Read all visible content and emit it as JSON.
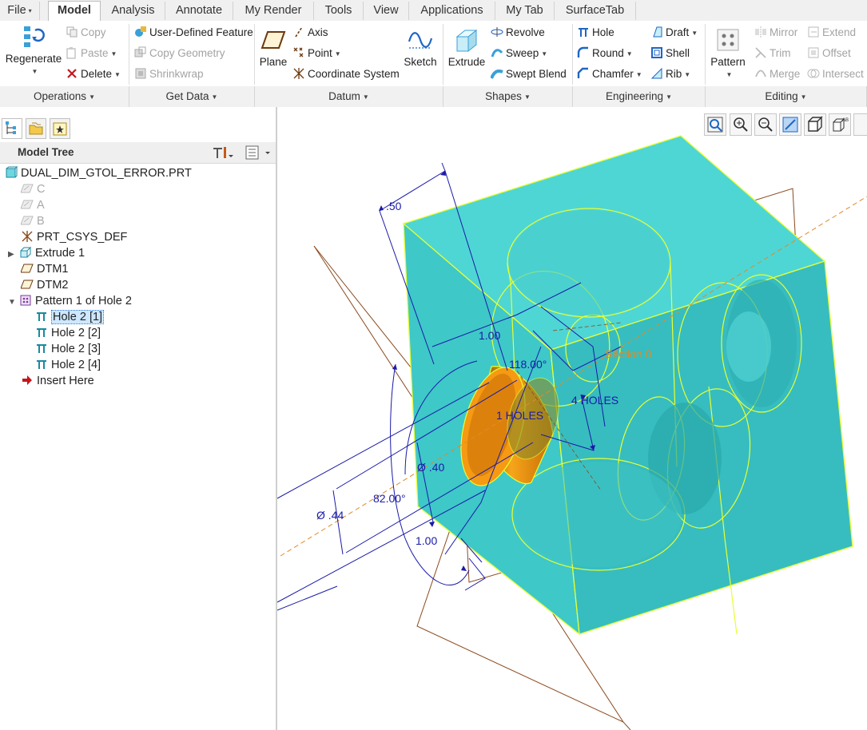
{
  "tabs": [
    {
      "label": "File",
      "caret": "▾"
    },
    {
      "label": "Model"
    },
    {
      "label": "Analysis"
    },
    {
      "label": "Annotate"
    },
    {
      "label": "My Render"
    },
    {
      "label": "Tools"
    },
    {
      "label": "View"
    },
    {
      "label": "Applications"
    },
    {
      "label": "My Tab"
    },
    {
      "label": "SurfaceTab"
    }
  ],
  "ribbon": {
    "regenerate": "Regenerate",
    "copy": "Copy",
    "paste": "Paste",
    "delete": "Delete",
    "user_defined_feature": "User-Defined Feature",
    "copy_geometry": "Copy Geometry",
    "shrinkwrap": "Shrinkwrap",
    "plane": "Plane",
    "axis": "Axis",
    "point": "Point",
    "coordinate_system": "Coordinate System",
    "sketch": "Sketch",
    "extrude": "Extrude",
    "revolve": "Revolve",
    "sweep": "Sweep",
    "swept_blend": "Swept Blend",
    "hole": "Hole",
    "round": "Round",
    "chamfer": "Chamfer",
    "draft": "Draft",
    "shell": "Shell",
    "rib": "Rib",
    "pattern": "Pattern",
    "mirror": "Mirror",
    "trim": "Trim",
    "merge": "Merge",
    "extend": "Extend",
    "offset": "Offset",
    "intersect": "Intersect"
  },
  "groups": [
    "Operations",
    "Get Data",
    "Datum",
    "Shapes",
    "Engineering",
    "Editing"
  ],
  "model_tree": {
    "title": "Model Tree",
    "items": [
      {
        "label": "DUAL_DIM_GTOL_ERROR.PRT",
        "state": "normal"
      },
      {
        "label": "C",
        "state": "disabled"
      },
      {
        "label": "A",
        "state": "disabled"
      },
      {
        "label": "B",
        "state": "disabled"
      },
      {
        "label": "PRT_CSYS_DEF",
        "state": "normal"
      },
      {
        "label": "Extrude 1",
        "state": "normal"
      },
      {
        "label": "DTM1",
        "state": "normal"
      },
      {
        "label": "DTM2",
        "state": "normal"
      },
      {
        "label": "Pattern 1 of Hole 2",
        "state": "normal"
      },
      {
        "label": "Hole 2 [1]",
        "state": "selected"
      },
      {
        "label": "Hole 2 [2]",
        "state": "normal"
      },
      {
        "label": "Hole 2 [3]",
        "state": "normal"
      },
      {
        "label": "Hole 2 [4]",
        "state": "normal"
      },
      {
        "label": "Insert Here",
        "state": "normal"
      }
    ]
  },
  "annotations": {
    "dim_50": ".50",
    "dim_100_top": "1.00",
    "dim_118": "118.00°",
    "section": "Section 0",
    "holes_1": "1 HOLES",
    "holes_4": "4 HOLES",
    "dia_40": "Ø .40",
    "dia_44": "Ø .44",
    "dim_82": "82.00°",
    "dim_100_bottom": "1.00"
  },
  "colors": {
    "accent": "#3a7bd5",
    "model_fill": "#3ec8c8",
    "edge_yellow": "#e6ff33",
    "hole_orange": "#f59a12",
    "dimension_blue": "#1a1aa8",
    "datum_brown": "#8b4a1e",
    "section_orange": "#e08a2a"
  }
}
